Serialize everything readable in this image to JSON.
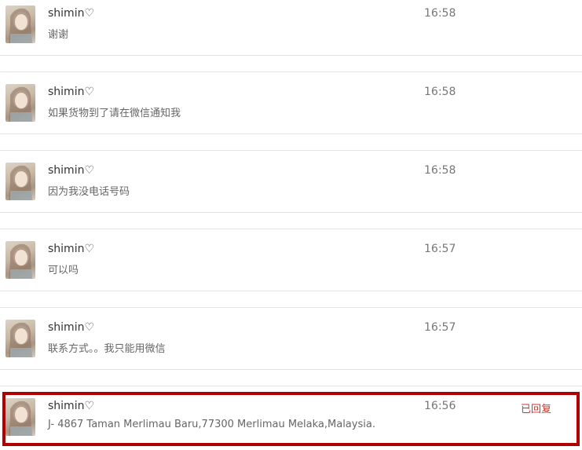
{
  "messages": [
    {
      "name": "shimin♡",
      "text": "谢谢",
      "time": "16:58",
      "status": ""
    },
    {
      "name": "shimin♡",
      "text": "如果货物到了请在微信通知我",
      "time": "16:58",
      "status": ""
    },
    {
      "name": "shimin♡",
      "text": "因为我没电话号码",
      "time": "16:58",
      "status": ""
    },
    {
      "name": "shimin♡",
      "text": "可以吗",
      "time": "16:57",
      "status": ""
    },
    {
      "name": "shimin♡",
      "text": "联系方式。。我只能用微信",
      "time": "16:57",
      "status": ""
    },
    {
      "name": "shimin♡",
      "text": "J- 4867 Taman Merlimau Baru,77300 Merlimau Melaka,Malaysia.",
      "time": "16:56",
      "status": "已回复",
      "highlighted": true
    }
  ],
  "colors": {
    "highlight_border": "#b00000",
    "replied_text": "#c0392b",
    "divider": "#e3e3e3"
  },
  "icons": {
    "avatar": "user-photo-avatar"
  }
}
